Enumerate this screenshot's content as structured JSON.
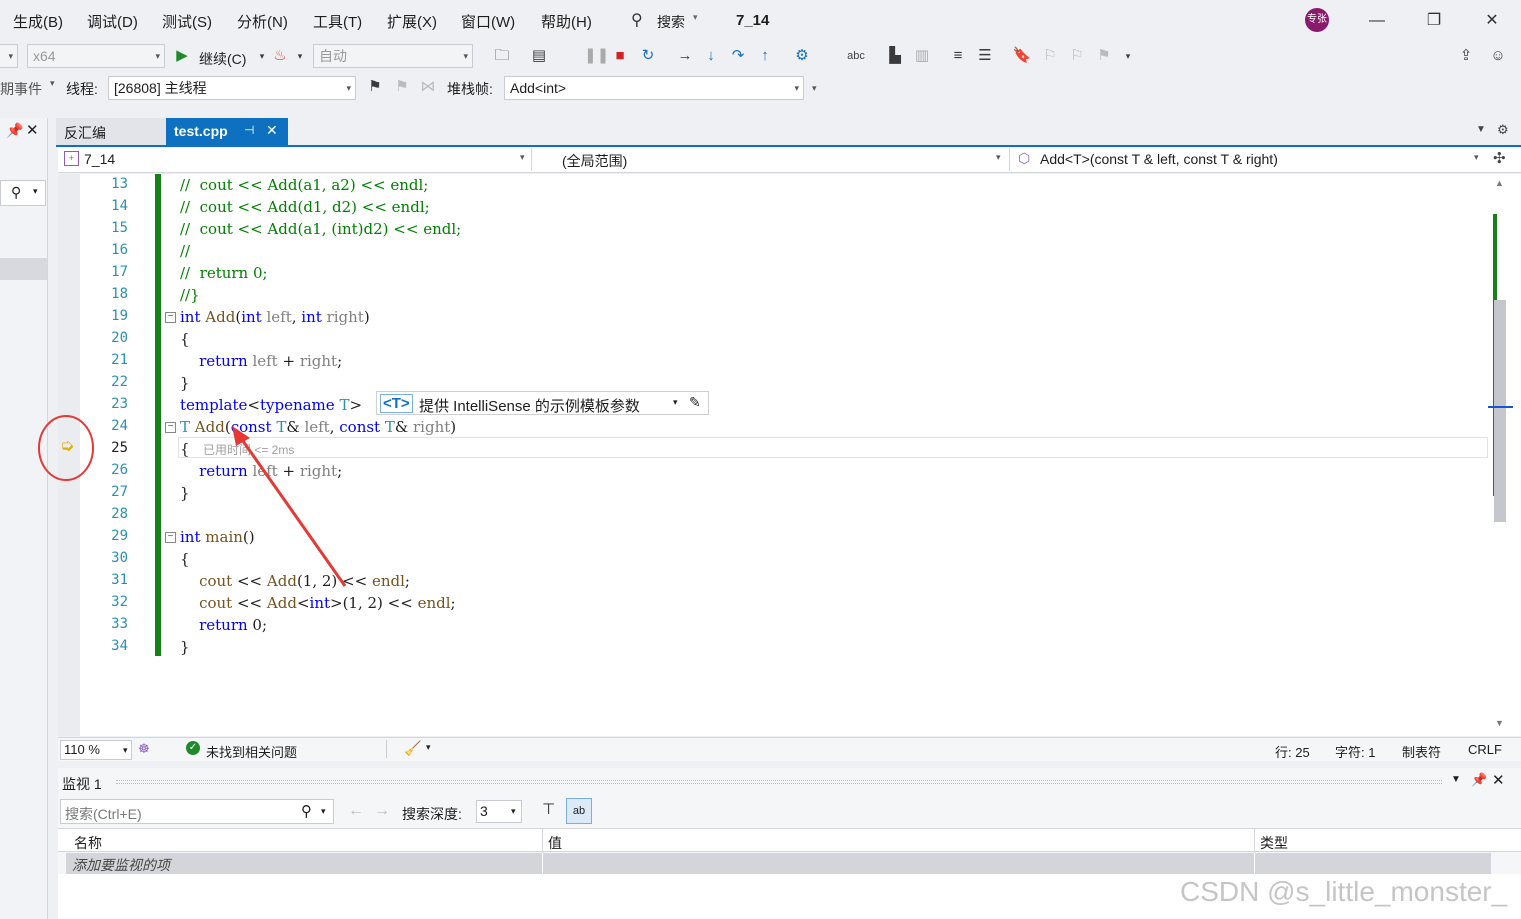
{
  "menu": {
    "items": [
      "生成(B)",
      "调试(D)",
      "测试(S)",
      "分析(N)",
      "工具(T)",
      "扩展(X)",
      "窗口(W)",
      "帮助(H)"
    ],
    "search_label": "搜索",
    "solution_name": "7_14",
    "avatar_text": "专张"
  },
  "toolbar": {
    "platform": "x64",
    "continue_label": "继续(C)",
    "auto_combo": "自动",
    "events_label": "期事件",
    "thread_label": "线程:",
    "thread_value": "[26808] 主线程",
    "stackframe_label": "堆栈帧:",
    "stackframe_value": "Add<int>"
  },
  "tabs": {
    "inactive": "反汇编",
    "active": "test.cpp"
  },
  "navbar": {
    "project": "7_14",
    "scope": "(全局范围)",
    "member": "Add<T>(const T & left, const T & right)"
  },
  "editor": {
    "lines": [
      {
        "num": "13",
        "segments": [
          {
            "c": "cm",
            "t": "//  cout << Add(a1, a2) << endl;"
          }
        ]
      },
      {
        "num": "14",
        "segments": [
          {
            "c": "cm",
            "t": "//  cout << Add(d1, d2) << endl;"
          }
        ]
      },
      {
        "num": "15",
        "segments": [
          {
            "c": "cm",
            "t": "//  cout << Add(a1, (int)d2) << endl;"
          }
        ]
      },
      {
        "num": "16",
        "segments": [
          {
            "c": "cm",
            "t": "//"
          }
        ]
      },
      {
        "num": "17",
        "segments": [
          {
            "c": "cm",
            "t": "//  return 0;"
          }
        ]
      },
      {
        "num": "18",
        "segments": [
          {
            "c": "cm",
            "t": "//}"
          }
        ]
      },
      {
        "num": "19",
        "segments": [
          {
            "c": "kw",
            "t": "int"
          },
          {
            "c": "pl",
            "t": " "
          },
          {
            "c": "fn",
            "t": "Add"
          },
          {
            "c": "pl",
            "t": "("
          },
          {
            "c": "kw",
            "t": "int"
          },
          {
            "c": "pl",
            "t": " "
          },
          {
            "c": "pm",
            "t": "left"
          },
          {
            "c": "pl",
            "t": ", "
          },
          {
            "c": "kw",
            "t": "int"
          },
          {
            "c": "pl",
            "t": " "
          },
          {
            "c": "pm",
            "t": "right"
          },
          {
            "c": "pl",
            "t": ")"
          }
        ]
      },
      {
        "num": "20",
        "segments": [
          {
            "c": "pl",
            "t": "{"
          }
        ]
      },
      {
        "num": "21",
        "segments": [
          {
            "c": "pl",
            "t": "    "
          },
          {
            "c": "kw",
            "t": "return"
          },
          {
            "c": "pl",
            "t": " "
          },
          {
            "c": "pm",
            "t": "left"
          },
          {
            "c": "pl",
            "t": " + "
          },
          {
            "c": "pm",
            "t": "right"
          },
          {
            "c": "pl",
            "t": ";"
          }
        ]
      },
      {
        "num": "22",
        "segments": [
          {
            "c": "pl",
            "t": "}"
          }
        ]
      },
      {
        "num": "23",
        "segments": [
          {
            "c": "kw",
            "t": "template"
          },
          {
            "c": "pl",
            "t": "<"
          },
          {
            "c": "kw",
            "t": "typename"
          },
          {
            "c": "pl",
            "t": " "
          },
          {
            "c": "tp",
            "t": "T"
          },
          {
            "c": "pl",
            "t": ">"
          }
        ]
      },
      {
        "num": "24",
        "segments": [
          {
            "c": "tp",
            "t": "T"
          },
          {
            "c": "pl",
            "t": " "
          },
          {
            "c": "fn",
            "t": "Add"
          },
          {
            "c": "pl",
            "t": "("
          },
          {
            "c": "kw",
            "t": "const"
          },
          {
            "c": "pl",
            "t": " "
          },
          {
            "c": "tp",
            "t": "T"
          },
          {
            "c": "pl",
            "t": "& "
          },
          {
            "c": "pm",
            "t": "left"
          },
          {
            "c": "pl",
            "t": ", "
          },
          {
            "c": "kw",
            "t": "const"
          },
          {
            "c": "pl",
            "t": " "
          },
          {
            "c": "tp",
            "t": "T"
          },
          {
            "c": "pl",
            "t": "& "
          },
          {
            "c": "pm",
            "t": "right"
          },
          {
            "c": "pl",
            "t": ")"
          }
        ]
      },
      {
        "num": "25",
        "segments": [
          {
            "c": "pl",
            "t": "{"
          }
        ]
      },
      {
        "num": "26",
        "segments": [
          {
            "c": "pl",
            "t": "    "
          },
          {
            "c": "kw",
            "t": "return"
          },
          {
            "c": "pl",
            "t": " "
          },
          {
            "c": "pm",
            "t": "left"
          },
          {
            "c": "pl",
            "t": " + "
          },
          {
            "c": "pm",
            "t": "right"
          },
          {
            "c": "pl",
            "t": ";"
          }
        ]
      },
      {
        "num": "27",
        "segments": [
          {
            "c": "pl",
            "t": "}"
          }
        ]
      },
      {
        "num": "28",
        "segments": []
      },
      {
        "num": "29",
        "segments": [
          {
            "c": "kw",
            "t": "int"
          },
          {
            "c": "pl",
            "t": " "
          },
          {
            "c": "fn",
            "t": "main"
          },
          {
            "c": "pl",
            "t": "()"
          }
        ]
      },
      {
        "num": "30",
        "segments": [
          {
            "c": "pl",
            "t": "{"
          }
        ]
      },
      {
        "num": "31",
        "segments": [
          {
            "c": "pl",
            "t": "    "
          },
          {
            "c": "fn",
            "t": "cout"
          },
          {
            "c": "pl",
            "t": " << "
          },
          {
            "c": "fn",
            "t": "Add"
          },
          {
            "c": "pl",
            "t": "(1, 2) << "
          },
          {
            "c": "fn",
            "t": "endl"
          },
          {
            "c": "pl",
            "t": ";"
          }
        ]
      },
      {
        "num": "32",
        "segments": [
          {
            "c": "pl",
            "t": "    "
          },
          {
            "c": "fn",
            "t": "cout"
          },
          {
            "c": "pl",
            "t": " << "
          },
          {
            "c": "fn",
            "t": "Add"
          },
          {
            "c": "pl",
            "t": "<"
          },
          {
            "c": "kw",
            "t": "int"
          },
          {
            "c": "pl",
            "t": ">(1, 2) << "
          },
          {
            "c": "fn",
            "t": "endl"
          },
          {
            "c": "pl",
            "t": ";"
          }
        ]
      },
      {
        "num": "33",
        "segments": [
          {
            "c": "pl",
            "t": "    "
          },
          {
            "c": "kw",
            "t": "return"
          },
          {
            "c": "pl",
            "t": " 0;"
          }
        ]
      },
      {
        "num": "34",
        "segments": [
          {
            "c": "pl",
            "t": "}"
          }
        ]
      }
    ],
    "current_line": "25",
    "intellisense_tag": "<T>",
    "intellisense_text": "提供 IntelliSense 的示例模板参数",
    "elapsed_hint": "已用时间 <= 2ms"
  },
  "status": {
    "zoom": "110 %",
    "issues": "未找到相关问题",
    "line": "行: 25",
    "char": "字符: 1",
    "tabs": "制表符",
    "eol": "CRLF"
  },
  "watch": {
    "title": "监视 1",
    "search_placeholder": "搜索(Ctrl+E)",
    "depth_label": "搜索深度:",
    "depth_value": "3",
    "col_name": "名称",
    "col_value": "值",
    "col_type": "类型",
    "add_row": "添加要监视的项"
  },
  "watermark": "CSDN @s_little_monster_",
  "colors": {
    "accent": "#0e70c0",
    "change_bar": "#188018",
    "annotation": "#e53935"
  }
}
